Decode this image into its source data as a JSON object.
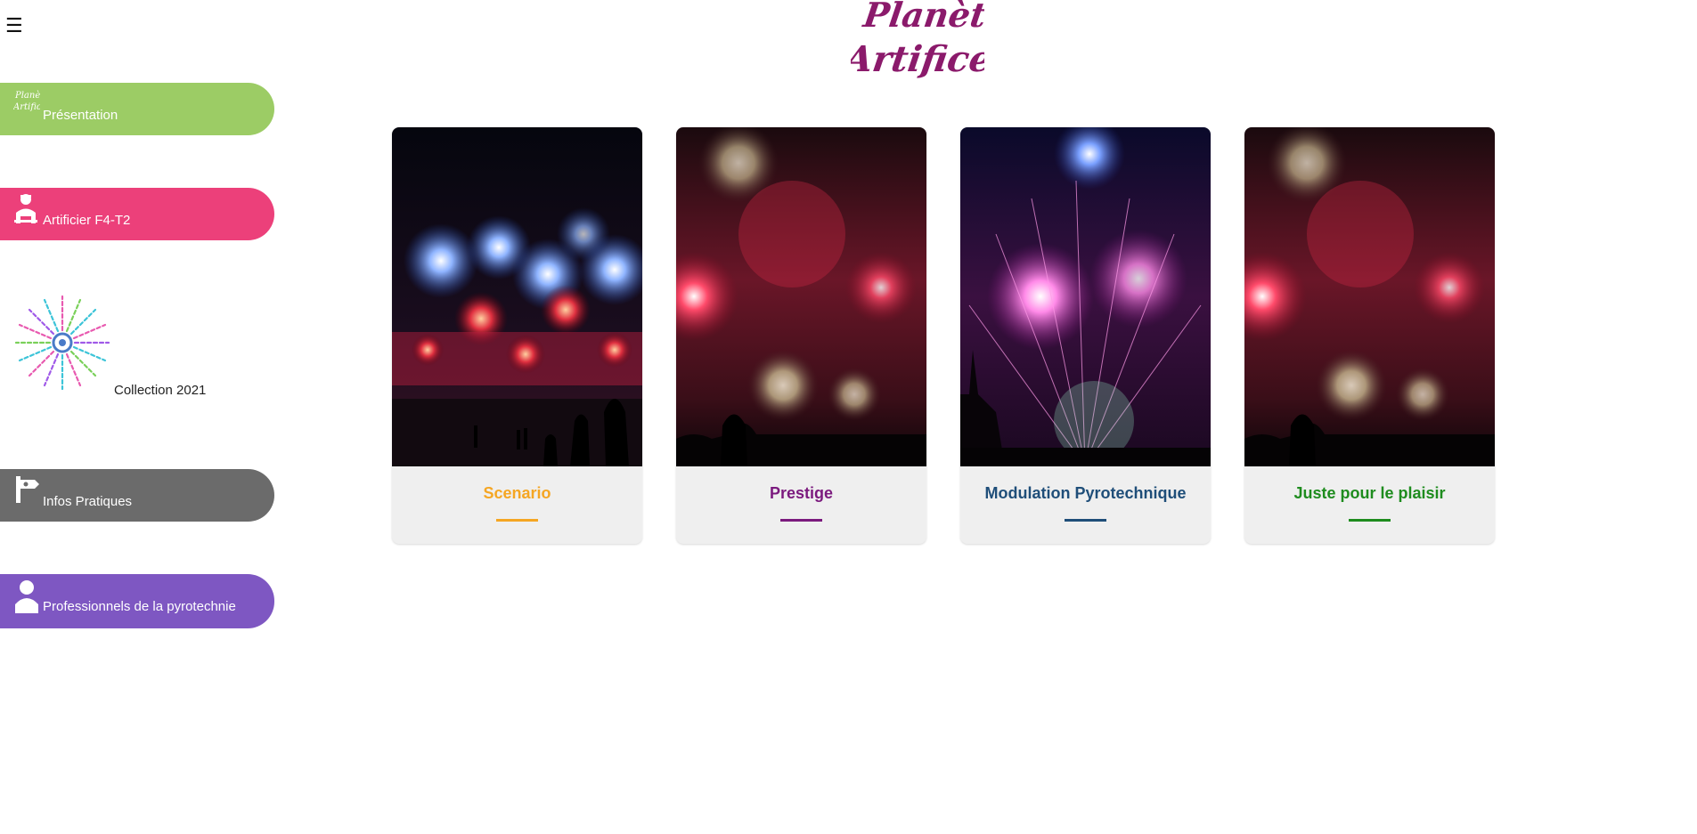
{
  "header": {
    "menu_icon": "hamburger-icon",
    "logo_line1": "Planète",
    "logo_line2": "Artifices",
    "logo_color": "#8b1a6b"
  },
  "sidebar": {
    "items": [
      {
        "label": "Présentation",
        "icon": "planete-artifices-mini-logo",
        "color": "#9ccc65"
      },
      {
        "label": "Artificier F4-T2",
        "icon": "artificer-person-icon",
        "color": "#ec407a"
      },
      {
        "label": "Collection 2021",
        "icon": "firework-burst-icon",
        "color": "#ffffff"
      },
      {
        "label": "Infos Pratiques",
        "icon": "signpost-icon",
        "color": "#6b6b6b"
      },
      {
        "label": "Professionnels de la pyrotechnie",
        "icon": "person-icon",
        "color": "#7e57c2"
      }
    ]
  },
  "cards": [
    {
      "title": "Scenario",
      "color": "#f5a623"
    },
    {
      "title": "Prestige",
      "color": "#7b1a7e"
    },
    {
      "title": "Modulation Pyrotechnique",
      "color": "#1f4e79"
    },
    {
      "title": "Juste pour le plaisir",
      "color": "#1e8c1e"
    }
  ]
}
